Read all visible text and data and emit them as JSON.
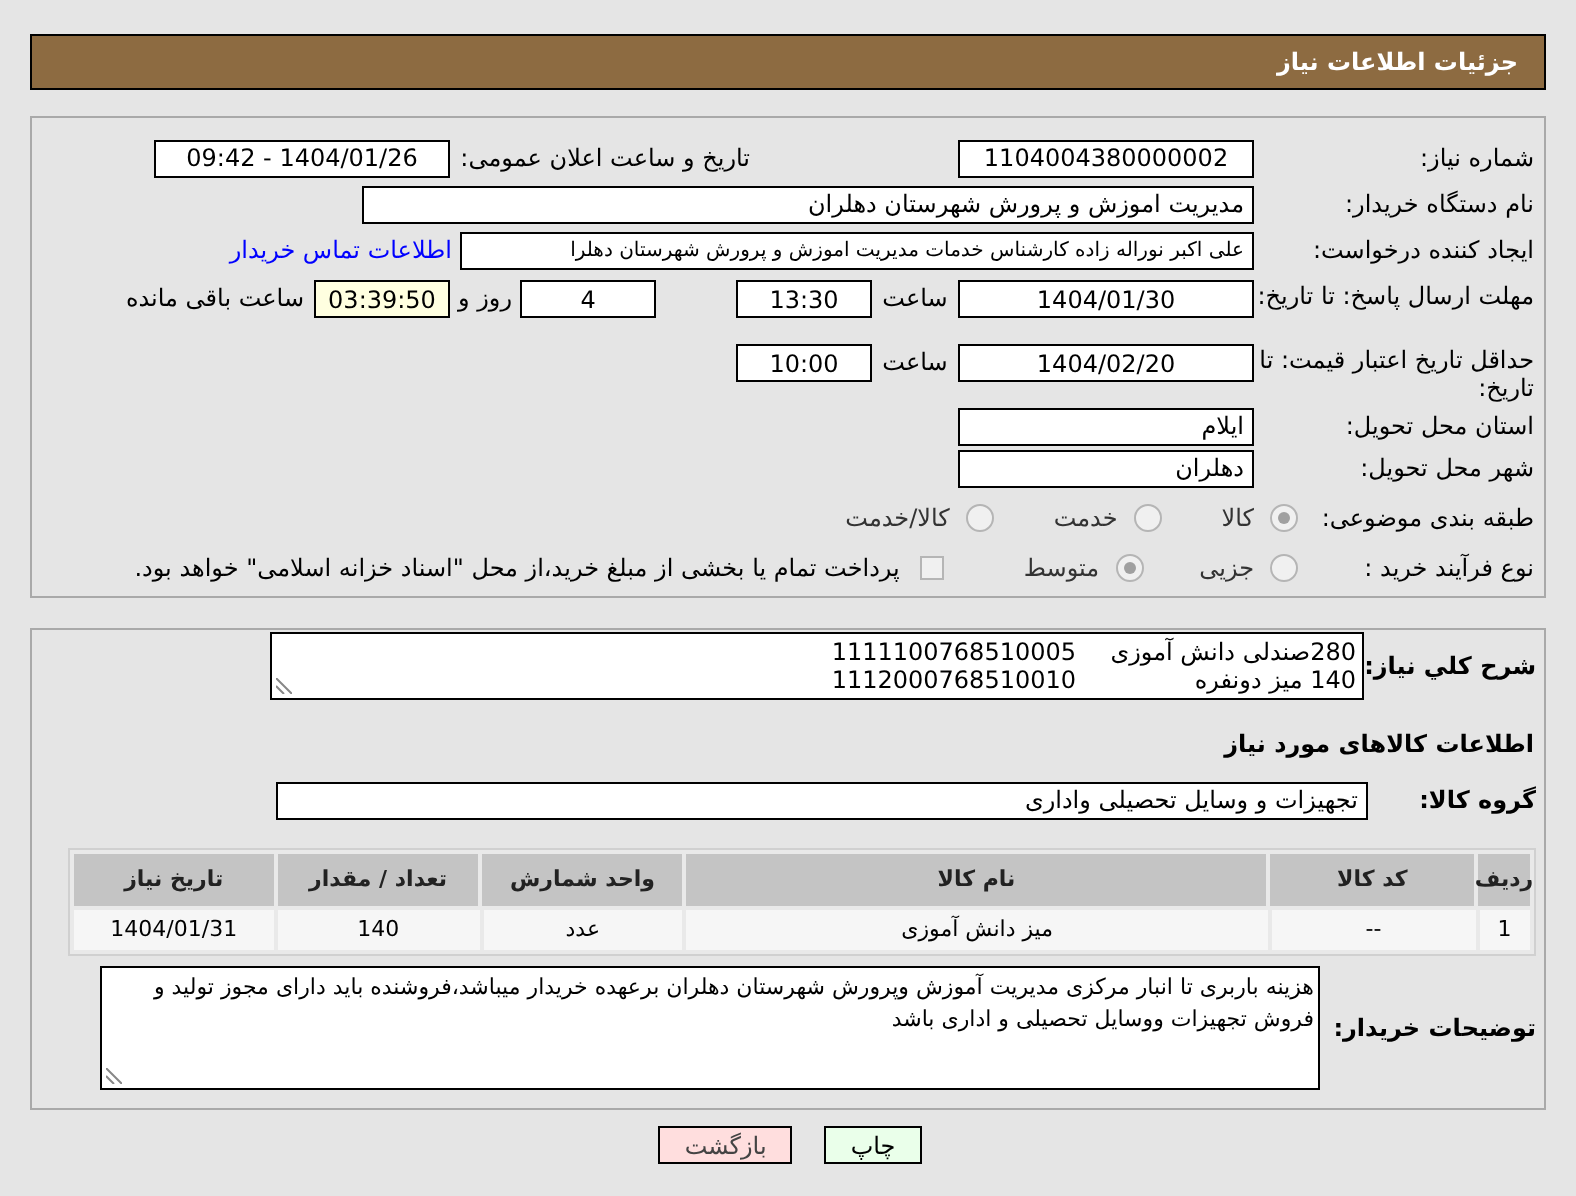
{
  "header": {
    "title": "جزئیات اطلاعات نیاز"
  },
  "details": {
    "need_number": {
      "label": "شماره نیاز:",
      "value": "1104004380000002"
    },
    "announce": {
      "label": "تاریخ و ساعت اعلان عمومی:",
      "value": "1404/01/26 - 09:42"
    },
    "buyer": {
      "label": "نام دستگاه خریدار:",
      "value": "مدیریت اموزش و پرورش شهرستان دهلران"
    },
    "creator": {
      "label": "ایجاد کننده درخواست:",
      "value": "علی اکبر نوراله زاده کارشناس خدمات مدیریت اموزش و پرورش شهرستان دهلرا",
      "link": "اطلاعات تماس خریدار"
    },
    "deadline": {
      "label": "مهلت ارسال پاسخ: تا تاریخ:",
      "date": "1404/01/30",
      "time_label": "ساعت",
      "time": "13:30",
      "days": "4",
      "days_label": "روز و",
      "remaining": "03:39:50",
      "remaining_label": "ساعت باقی مانده"
    },
    "validity": {
      "label": "حداقل تاریخ اعتبار قیمت: تا تاریخ:",
      "date": "1404/02/20",
      "time_label": "ساعت",
      "time": "10:00"
    },
    "province": {
      "label": "استان محل تحویل:",
      "value": "ایلام"
    },
    "city": {
      "label": "شهر محل تحویل:",
      "value": "دهلران"
    },
    "category": {
      "label": "طبقه بندی موضوعی:",
      "options": [
        {
          "label": "کالا",
          "selected": true
        },
        {
          "label": "خدمت",
          "selected": false
        },
        {
          "label": "کالا/خدمت",
          "selected": false
        }
      ]
    },
    "process": {
      "label": "نوع فرآیند خرید :",
      "options": [
        {
          "label": "جزیی",
          "selected": false
        },
        {
          "label": "متوسط",
          "selected": true
        }
      ],
      "treasury": {
        "label": "پرداخت تمام یا بخشی از مبلغ خرید،از محل \"اسناد خزانه اسلامی\" خواهد بود.",
        "checked": false
      }
    }
  },
  "summary": {
    "label": "شرح کلي نیاز:",
    "lines": [
      {
        "text": "280صندلی دانش آموزی",
        "code": "1111100768510005"
      },
      {
        "text": "140 میز دونفره",
        "code": "1112000768510010"
      }
    ]
  },
  "goods_heading": "اطلاعات کالاهای مورد نیاز",
  "goods_group": {
    "label": "گروه کالا:",
    "value": "تجهیزات و وسایل تحصیلی واداری"
  },
  "table": {
    "columns": [
      "ردیف",
      "کد کالا",
      "نام کالا",
      "واحد شمارش",
      "تعداد / مقدار",
      "تاریخ نیاز"
    ],
    "rows": [
      [
        "1",
        "--",
        "میز دانش آموزی",
        "عدد",
        "140",
        "1404/01/31"
      ]
    ]
  },
  "notes": {
    "label": "توضیحات خریدار:",
    "value": "هزینه باربری تا انبار مرکزی مدیریت آموزش وپرورش شهرستان دهلران برعهده خریدار میباشد،فروشنده باید دارای مجوز تولید و فروش تجهیزات ووسایل تحصیلی و اداری باشد"
  },
  "buttons": [
    {
      "label": "چاپ",
      "kind": "print"
    },
    {
      "label": "بازگشت",
      "kind": "back"
    }
  ]
}
